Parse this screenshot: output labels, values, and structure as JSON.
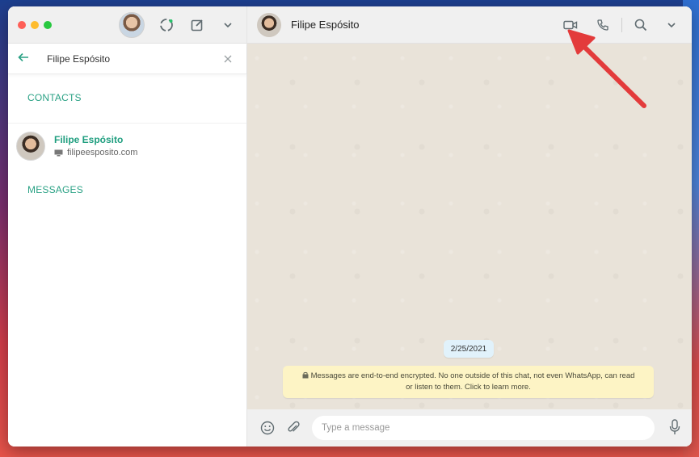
{
  "sidebar": {
    "search": {
      "value": "Filipe Espósito"
    },
    "contacts_label": "CONTACTS",
    "contacts": [
      {
        "name": "Filipe Espósito",
        "subtitle": "filipeesposito.com"
      }
    ],
    "messages_label": "MESSAGES"
  },
  "chat": {
    "title": "Filipe Espósito",
    "date_chip": "2/25/2021",
    "encryption_note_line1": "Messages are end-to-end encrypted. No one outside of this chat, not even WhatsApp, can read",
    "encryption_note_line2": "or listen to them. Click to learn more.",
    "input_placeholder": "Type a message"
  },
  "colors": {
    "accent": "#29a184",
    "chat_background": "#e9e3d9",
    "note_background": "#fdf4c5",
    "date_chip_background": "#e1f2fb",
    "annotation_arrow": "#e33b3b"
  },
  "icons": [
    "status-icon",
    "new-chat-icon",
    "chevron-down-icon",
    "back-arrow-icon",
    "close-icon",
    "video-call-icon",
    "phone-icon",
    "search-icon",
    "emoji-icon",
    "attach-icon",
    "mic-icon",
    "lock-icon",
    "website-icon"
  ]
}
